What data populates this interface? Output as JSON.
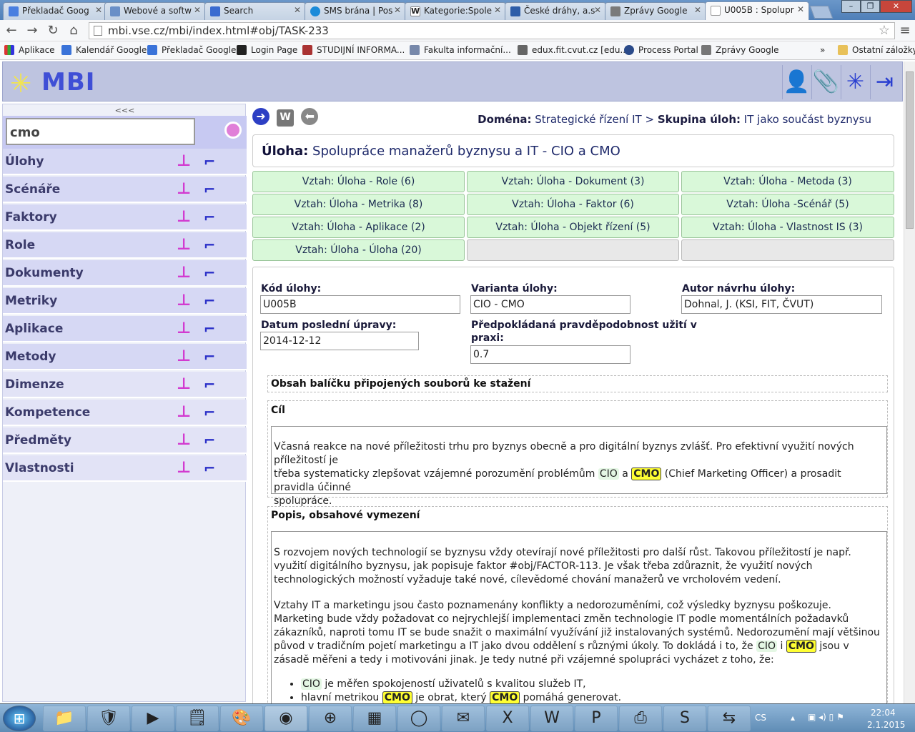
{
  "browser": {
    "tabs": [
      {
        "label": "Překladač Goog",
        "color": "#4a7fe0"
      },
      {
        "label": "Webové a softw",
        "color": "#6a8fc7"
      },
      {
        "label": "Search",
        "color": "#3a6bd0"
      },
      {
        "label": "SMS brána | Pos",
        "color": "#1b8bd9"
      },
      {
        "label": "Kategorie:Spole",
        "color": "#ffffff"
      },
      {
        "label": "České dráhy, a.s",
        "color": "#2d5da8"
      },
      {
        "label": "Zprávy Google",
        "color": "#7a7a7a"
      },
      {
        "label": "U005B : Spolupr",
        "color": "#bbbbbb"
      }
    ],
    "url": "mbi.vse.cz/mbi/index.html#obj/TASK-233",
    "bookmarks": [
      {
        "label": "Aplikace",
        "color": "#d33"
      },
      {
        "label": "Kalendář Google",
        "color": "#3a73d9"
      },
      {
        "label": "Překladač Google",
        "color": "#3a73d9"
      },
      {
        "label": "Login Page",
        "color": "#222"
      },
      {
        "label": "STUDIJNÍ INFORMA...",
        "color": "#a33"
      },
      {
        "label": "Fakulta informační...",
        "color": "#78a"
      },
      {
        "label": "edux.fit.cvut.cz [edu...",
        "color": "#666"
      },
      {
        "label": "Process Portal",
        "color": "#2a4a8a"
      },
      {
        "label": "Zprávy Google",
        "color": "#777"
      }
    ],
    "bookmarks_more": "»",
    "other_bookmarks": "Ostatní záložky"
  },
  "header": {
    "logo": "MBI"
  },
  "sidebar": {
    "collapse": "<<<",
    "search_value": "cmo",
    "items": [
      {
        "label": "Úlohy"
      },
      {
        "label": "Scénáře"
      },
      {
        "label": "Faktory"
      },
      {
        "label": "Role"
      },
      {
        "label": "Dokumenty"
      },
      {
        "label": "Metriky"
      },
      {
        "label": "Aplikace"
      },
      {
        "label": "Metody"
      },
      {
        "label": "Dimenze"
      },
      {
        "label": "Kompetence"
      },
      {
        "label": "Předměty"
      },
      {
        "label": "Vlastnosti"
      }
    ]
  },
  "main": {
    "domain_label": "Doména:",
    "domain_value": "Strategické řízení IT",
    "sep": ">",
    "group_label": "Skupina úloh:",
    "group_value": "IT jako součást byznysu",
    "task_label": "Úloha:",
    "task_title": "Spolupráce manažerů byznysu a IT - CIO a CMO",
    "relations": [
      "Vztah: Úloha - Role (6)",
      "Vztah: Úloha - Dokument (3)",
      "Vztah: Úloha - Metoda (3)",
      "Vztah: Úloha - Metrika (8)",
      "Vztah: Úloha - Faktor (6)",
      "Vztah: Úloha -Scénář (5)",
      "Vztah: Úloha - Aplikace (2)",
      "Vztah: Úloha - Objekt řízení (5)",
      "Vztah: Úloha - Vlastnost IS (3)",
      "Vztah: Úloha - Úloha (20)",
      "",
      ""
    ],
    "fields": {
      "code_label": "Kód úlohy:",
      "code_value": "U005B",
      "variant_label": "Varianta úlohy:",
      "variant_value": "CIO - CMO",
      "author_label": "Autor návrhu úlohy:",
      "author_value": "Dohnal, J. (KSI, FIT, ČVUT)",
      "date_label": "Datum poslední úpravy:",
      "date_value": "2014-12-12",
      "prob_label_1": "Předpokládaná pravděpodobnost užití v",
      "prob_label_2": "praxi:",
      "prob_value": "0.7"
    },
    "package_heading": "Obsah balíčku připojených souborů ke stažení",
    "goal_heading": "Cíl",
    "goal": {
      "t1": "Včasná reakce na nové příležitosti trhu pro byznys obecně a pro digitální byznys zvlášť. Pro efektivní využití nových příležitostí je",
      "t2": "třeba systematicky zlepšovat vzájemné porozumění problémům ",
      "cio": "CIO",
      "a": " a ",
      "cmo": "CMO",
      "t3": " (Chief Marketing Officer) a prosadit pravidla účinné",
      "t4": "spolupráce."
    },
    "desc_heading": "Popis, obsahové vymezení",
    "desc": {
      "p1": "S rozvojem nových technologií se byznysu vždy otevírají nové příležitosti pro další růst. Takovou příležitostí je např. využití digitálního byznysu, jak popisuje faktor #obj/FACTOR-113. Je však třeba zdůraznit, že využití nových technologických možností vyžaduje také nové, cílevědomé chování manažerů ve vrcholovém vedení.",
      "p2a": "Vztahy IT a marketingu jsou často poznamenány konflikty a nedorozuměními, což výsledky byznysu poškozuje. Marketing bude vždy požadovat co nejrychlejší implementaci změn technologie IT podle momentálních požadavků zákazníků, naproti tomu IT se bude snažit o maximální využívání již instalovaných systémů. Nedorozumění mají většinou původ v tradičním pojetí marketingu a IT jako dvou oddělení s různými úkoly. To dokládá i to, že ",
      "p2cio": "CIO",
      "p2i": " i ",
      "p2cmo": "CMO",
      "p2b": " jsou v zásadě měřeni a tedy i motivováni jinak. Je tedy nutné při vzájemné spolupráci vycházet z toho, že:",
      "li1a": "CIO",
      "li1b": " je měřen spokojeností uživatelů s kvalitou služeb IT,",
      "li2a": "hlavní metrikou ",
      "li2b": "CMO",
      "li2c": " je obrat, který ",
      "li2d": "CMO",
      "li2e": " pomáhá generovat."
    }
  },
  "taskbar": {
    "lang": "CS",
    "time": "22:04",
    "date": "2.1.2015"
  }
}
